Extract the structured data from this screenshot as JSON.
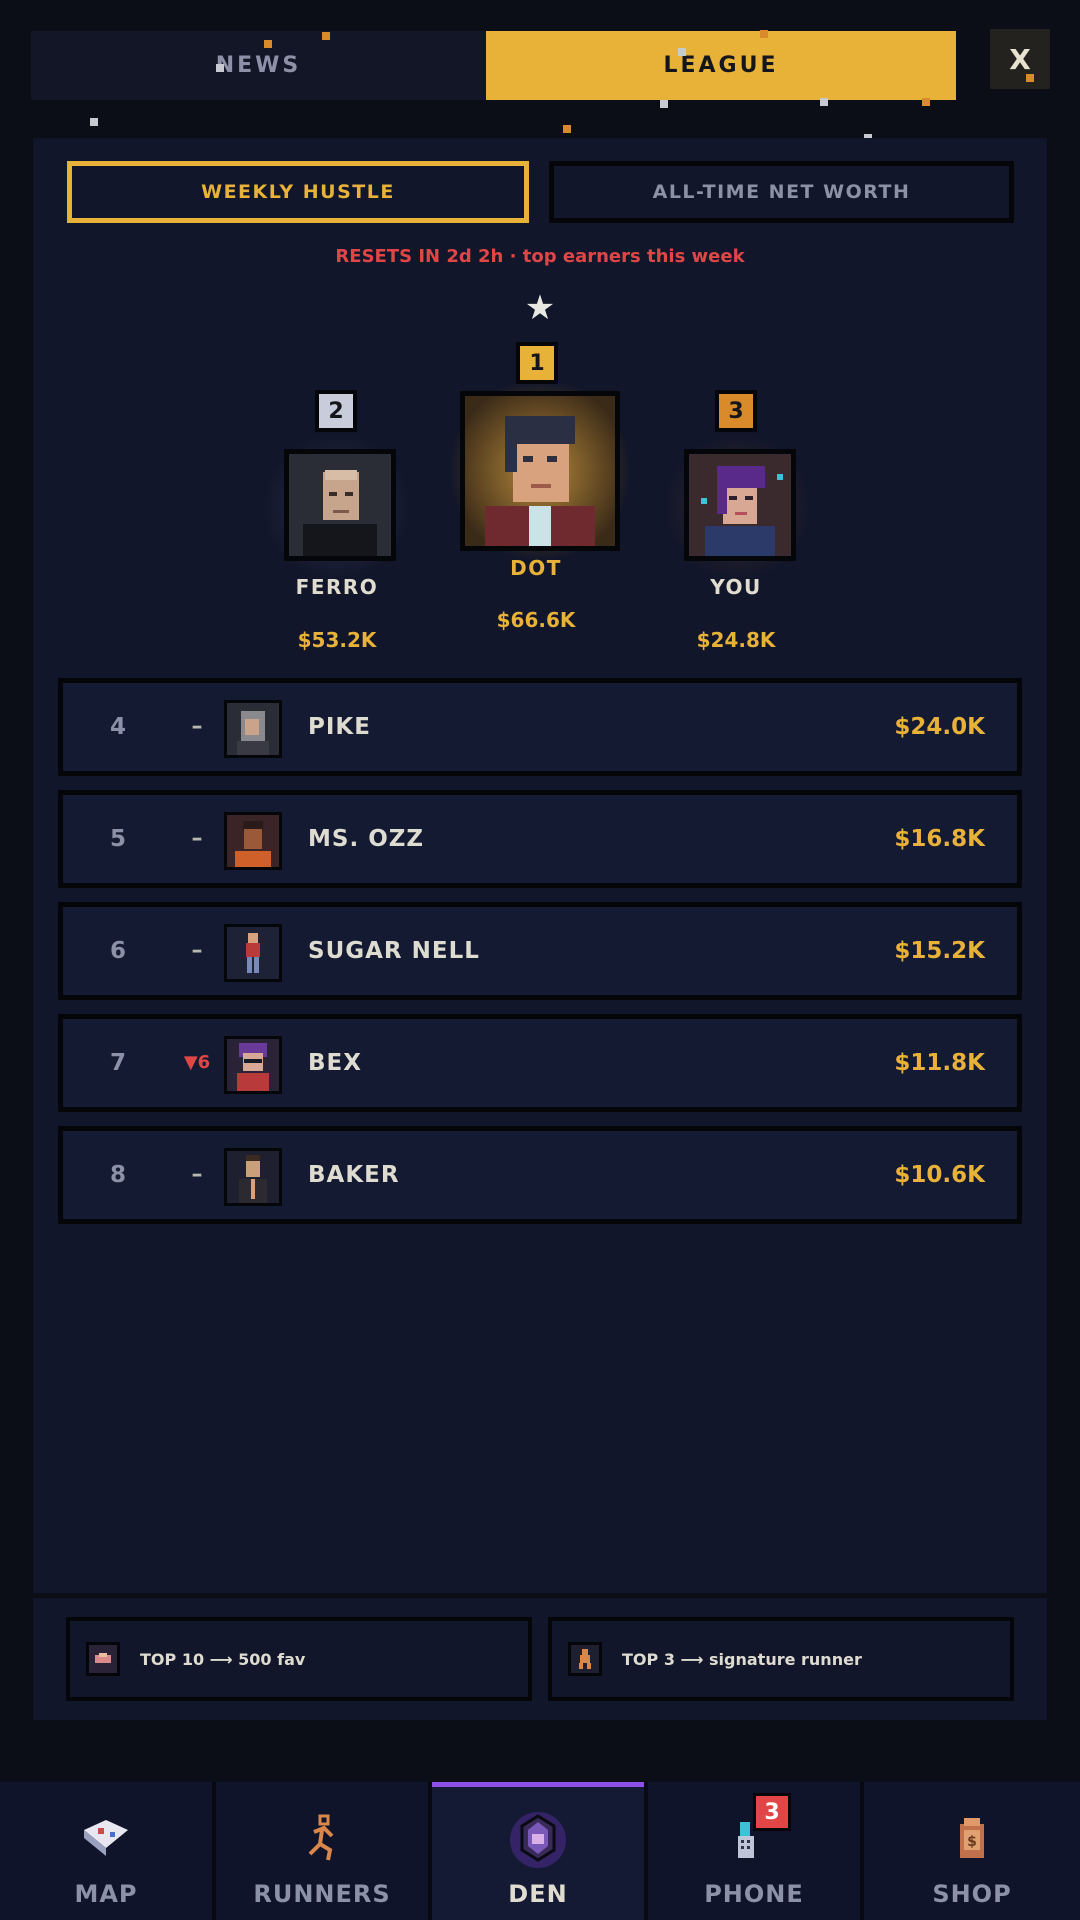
{
  "top_tabs": {
    "news": "NEWS",
    "league": "LEAGUE"
  },
  "close_label": "X",
  "sub_tabs": {
    "weekly": "WEEKLY HUSTLE",
    "alltime": "ALL-TIME NET WORTH"
  },
  "resets_text": "RESETS IN 2d 2h · top earners this week",
  "podium": {
    "first": {
      "rank": "1",
      "name": "DOT",
      "money": "$66.6K"
    },
    "second": {
      "rank": "2",
      "name": "FERRO",
      "money": "$53.2K"
    },
    "third": {
      "rank": "3",
      "name": "YOU",
      "money": "$24.8K"
    }
  },
  "rows": [
    {
      "rank": "4",
      "trend": "–",
      "name": "PIKE",
      "money": "$24.0K"
    },
    {
      "rank": "5",
      "trend": "–",
      "name": "MS. OZZ",
      "money": "$16.8K"
    },
    {
      "rank": "6",
      "trend": "–",
      "name": "SUGAR NELL",
      "money": "$15.2K"
    },
    {
      "rank": "7",
      "trend": "▼6",
      "name": "BEX",
      "money": "$11.8K"
    },
    {
      "rank": "8",
      "trend": "–",
      "name": "BAKER",
      "money": "$10.6K"
    }
  ],
  "rewards": [
    {
      "text": "TOP 10 ⟶ 500 fav",
      "icon": "favor-icon"
    },
    {
      "text": "TOP 3 ⟶ signature runner",
      "icon": "runner-icon"
    }
  ],
  "nav": [
    {
      "label": "MAP",
      "icon": "map-icon"
    },
    {
      "label": "RUNNERS",
      "icon": "runner-icon"
    },
    {
      "label": "DEN",
      "icon": "den-icon",
      "active": true
    },
    {
      "label": "PHONE",
      "icon": "phone-icon"
    },
    {
      "label": "SHOP",
      "icon": "shop-bag-icon"
    }
  ],
  "phone_badge": "3",
  "colors": {
    "accent": "#e8b138",
    "danger": "#e04646",
    "active_bar": "#8c4fe8",
    "bronze": "#d98a2b",
    "silver": "#c9ccdb"
  }
}
